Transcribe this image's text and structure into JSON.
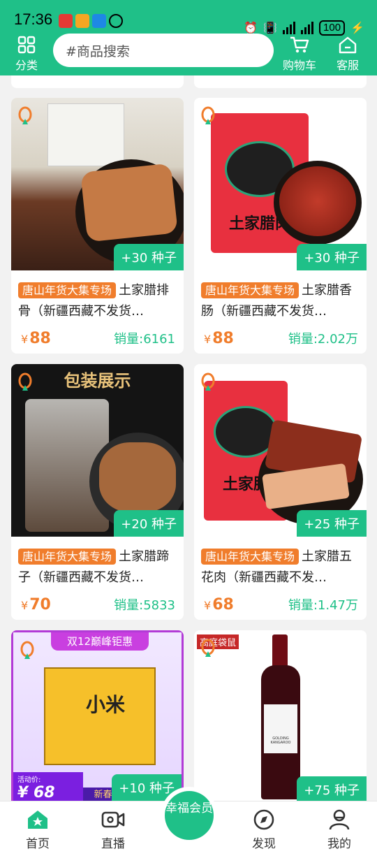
{
  "status_bar": {
    "time": "17:36",
    "battery": "100"
  },
  "header": {
    "category_label": "分类",
    "search_placeholder": "#商品搜索",
    "cart_label": "购物车",
    "service_label": "客服"
  },
  "products": [
    {
      "tag": "唐山年货大集专场",
      "title": "土家腊排骨（新疆西藏不发货…",
      "price_symbol": "¥",
      "price": "88",
      "sales": "销量:6161",
      "seeds": "+30 种子"
    },
    {
      "tag": "唐山年货大集专场",
      "title": "土家腊香肠（新疆西藏不发货…",
      "price_symbol": "¥",
      "price": "88",
      "sales": "销量:2.02万",
      "seeds": "+30 种子"
    },
    {
      "tag": "唐山年货大集专场",
      "title": "土家腊蹄子（新疆西藏不发货…",
      "price_symbol": "¥",
      "price": "70",
      "sales": "销量:5833",
      "seeds": "+20 种子"
    },
    {
      "tag": "唐山年货大集专场",
      "title": "土家腊五花肉（新疆西藏不发…",
      "price_symbol": "¥",
      "price": "68",
      "sales": "销量:1.47万",
      "seeds": "+25 种子"
    },
    {
      "seeds": "+10 种子",
      "banner": "双12巅峰钜惠",
      "box_text": "小米",
      "promo_label": "活动价:",
      "promo_price": "¥ 68",
      "promo_strip": "新春年"
    },
    {
      "seeds": "+75 种子",
      "banner": "高庭袋鼠",
      "wine_label": "GOLDING KANGAROO"
    }
  ],
  "image_texts": {
    "pkg_display": "包装展示",
    "bag_brand": "土家腊肉",
    "bag_brand2": "土家腊"
  },
  "nav": {
    "home": "首页",
    "live": "直播",
    "member": "幸福会员",
    "discover": "发现",
    "mine": "我的"
  },
  "colors": {
    "brand": "#1fc088",
    "accent": "#f07d2c"
  }
}
